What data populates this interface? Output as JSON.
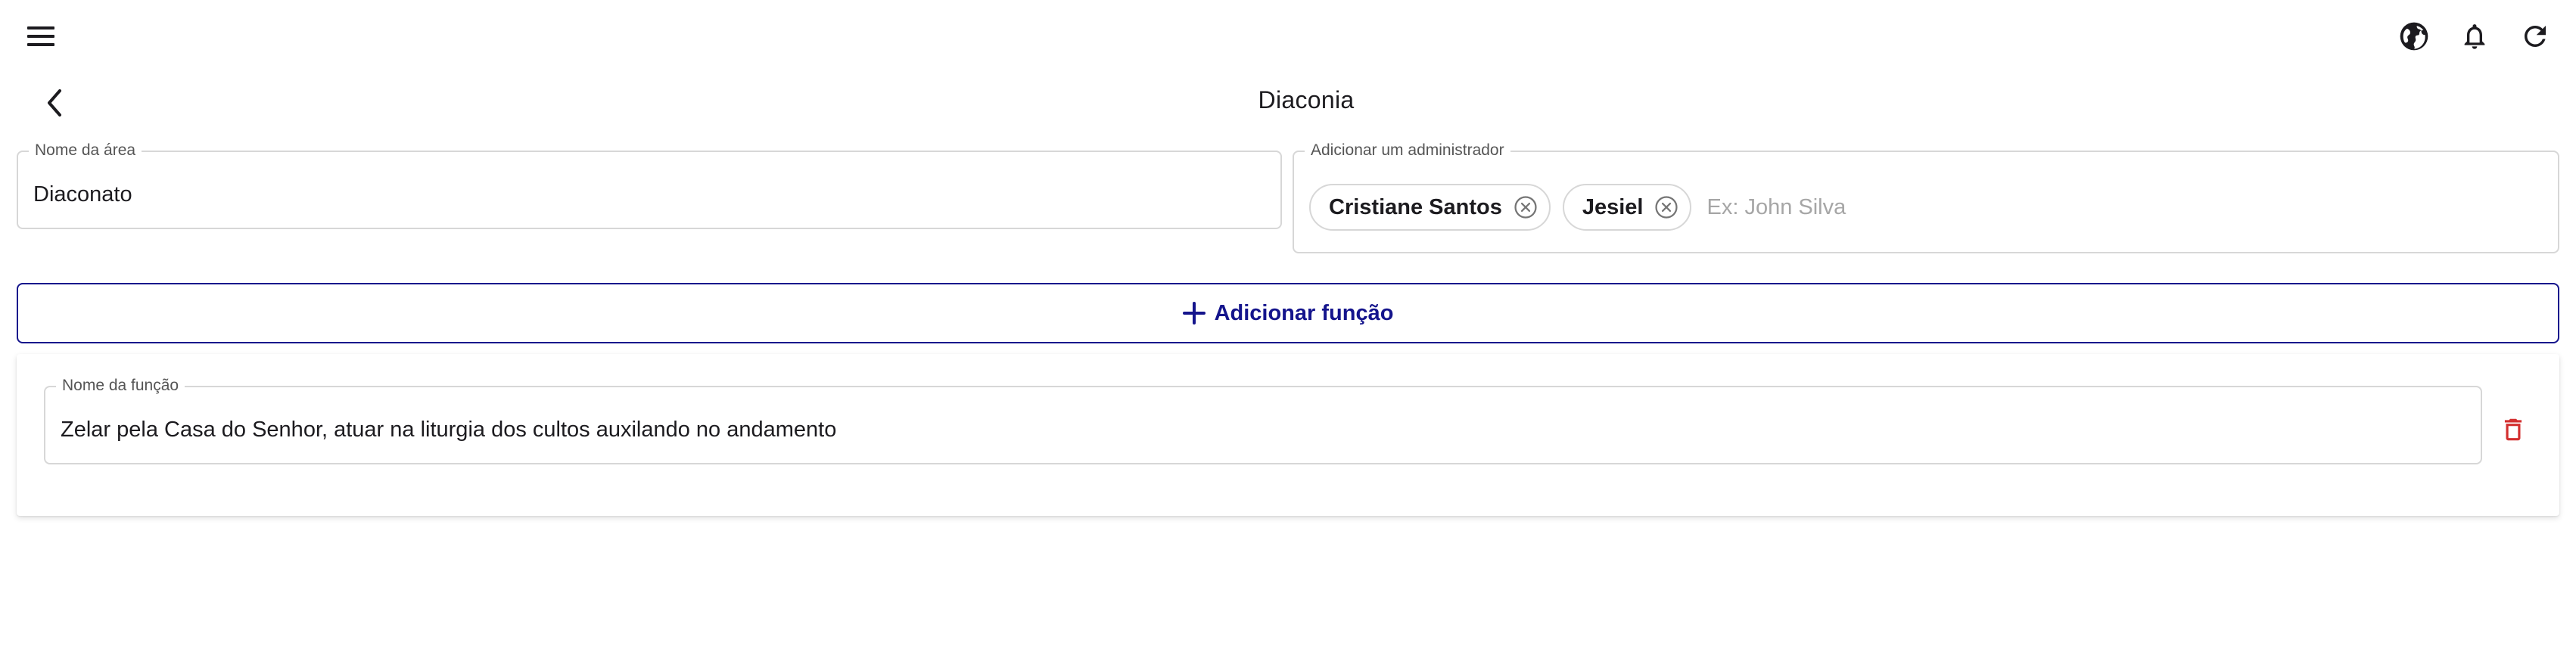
{
  "header": {
    "title": "Diaconia",
    "icons": [
      "menu-icon",
      "globe-icon",
      "bell-icon",
      "refresh-icon",
      "arrow-back-icon"
    ]
  },
  "area_name": {
    "label": "Nome da área",
    "value": "Diaconato"
  },
  "admins": {
    "label": "Adicionar um administrador",
    "chips": [
      "Cristiane Santos",
      "Jesiel"
    ],
    "placeholder": "Ex: John Silva"
  },
  "add_function": {
    "label": "Adicionar função",
    "icon": "plus-icon"
  },
  "functions": [
    {
      "label": "Nome da função",
      "value": "Zelar pela Casa do Senhor, atuar na liturgia dos cultos auxilando no andamento",
      "delete_icon": "trash-icon"
    }
  ],
  "colors": {
    "primary": "#14148c",
    "danger": "#d32f2f",
    "border": "#d7d7d7",
    "text": "#1c1b1f",
    "placeholder": "#a6a6a6"
  }
}
